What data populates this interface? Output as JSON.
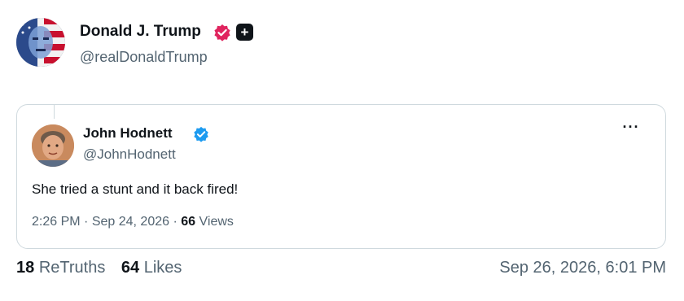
{
  "author": {
    "name": "Donald J. Trump",
    "handle": "@realDonaldTrump",
    "avatar_icon": "flag-face-avatar",
    "verified_badge_color": "#e0245e",
    "plus_badge_label": "+"
  },
  "quoted_post": {
    "author_name": "John Hodnett",
    "author_handle": "@JohnHodnett",
    "verified_badge_color": "#1d9bf0",
    "more_label": "···",
    "text": "She tried a stunt and it back fired!",
    "time": "2:26 PM",
    "date": "Sep 24, 2026",
    "views_count": "66",
    "views_label": "Views",
    "separator": "·"
  },
  "stats": {
    "retruths_count": "18",
    "retruths_label": "ReTruths",
    "likes_count": "64",
    "likes_label": "Likes"
  },
  "post_date": "Sep 26, 2026, 6:01 PM",
  "colors": {
    "text": "#0f1419",
    "secondary_text": "#536471",
    "border": "#cfd9de"
  }
}
